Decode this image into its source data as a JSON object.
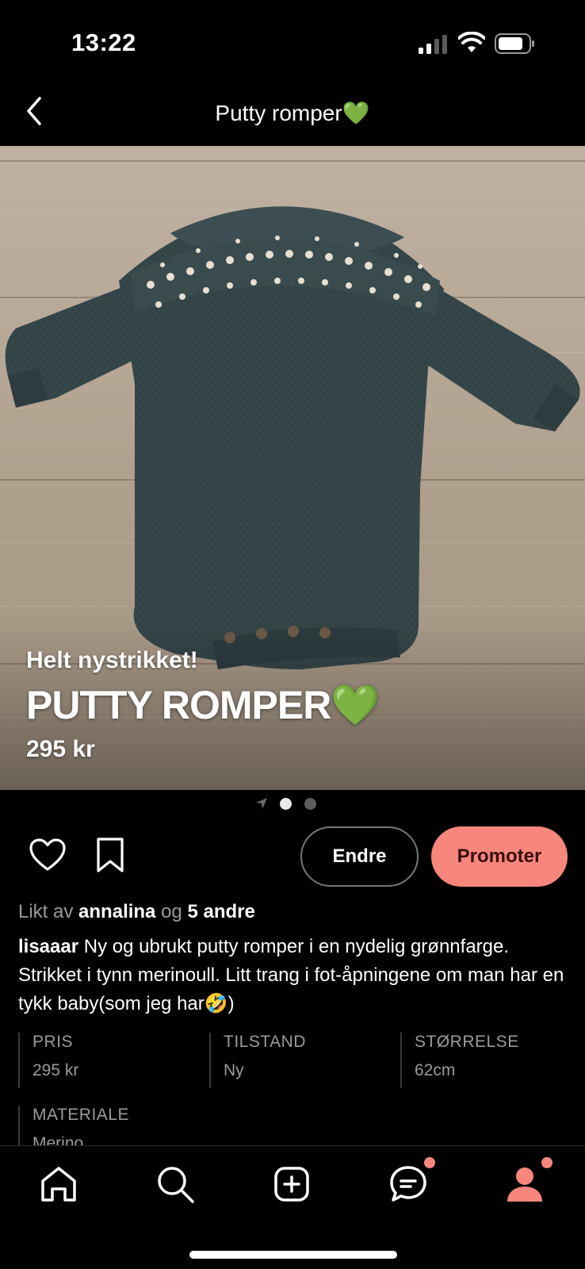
{
  "status_bar": {
    "time": "13:22"
  },
  "nav": {
    "title": "Putty romper💚"
  },
  "hero": {
    "subtitle": "Helt nystrikket!",
    "title": "PUTTY ROMPER💚",
    "price": "295 kr"
  },
  "pager": {
    "current_page": 1,
    "total_pages": 2
  },
  "actions": {
    "edit_label": "Endre",
    "promote_label": "Promoter"
  },
  "likes": {
    "prefix": "Likt av",
    "user": "annalina",
    "connector": "og",
    "others": "5 andre"
  },
  "description": {
    "username": "lisaaar",
    "text": "Ny og ubrukt putty romper i en nydelig grønnfarge. Strikket i tynn merinoull. Litt trang i fot-åpningene om man har en tykk baby(som jeg har🤣)"
  },
  "details": [
    {
      "label": "PRIS",
      "value": "295 kr"
    },
    {
      "label": "TILSTAND",
      "value": "Ny"
    },
    {
      "label": "STØRRELSE",
      "value": "62cm"
    },
    {
      "label": "MATERIALE",
      "value": "Merino"
    }
  ],
  "tabbar": {
    "items": [
      {
        "icon": "home-icon"
      },
      {
        "icon": "search-icon"
      },
      {
        "icon": "add-icon"
      },
      {
        "icon": "chat-icon",
        "badge": true
      },
      {
        "icon": "profile-icon",
        "badge": true,
        "active": true
      }
    ]
  },
  "colors": {
    "accent": "#f7877d",
    "background": "#000000",
    "muted_text": "#9a9a9a"
  }
}
